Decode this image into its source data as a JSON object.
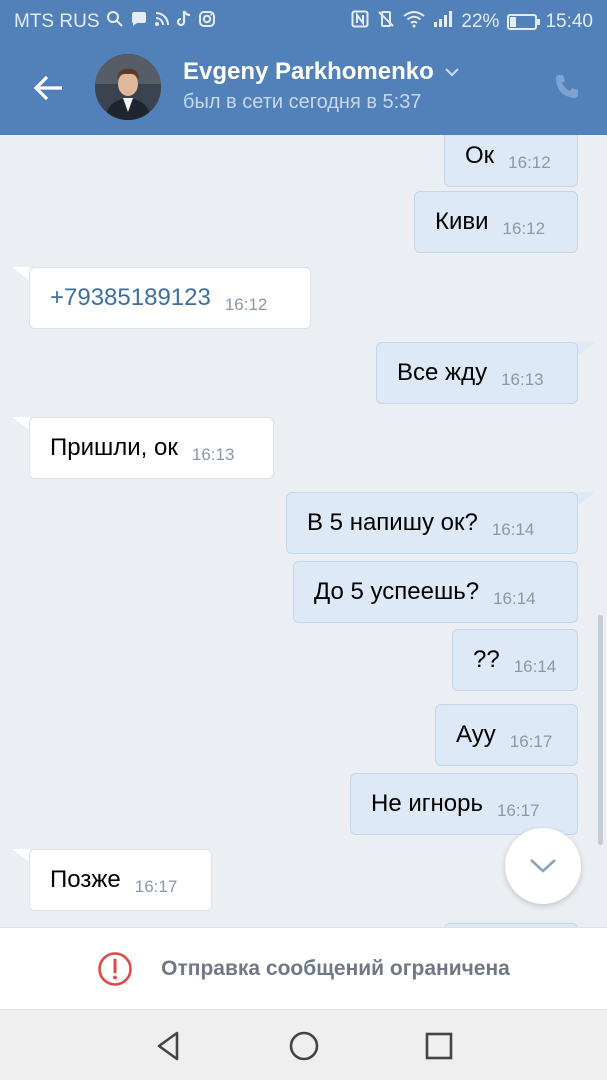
{
  "status_bar": {
    "carrier": "MTS RUS",
    "battery_percent_label": "22%",
    "battery_level": 0.22,
    "time": "15:40"
  },
  "header": {
    "contact_name": "Evgeny Parkhomenko",
    "last_seen": "был в сети сегодня в 5:37",
    "back_icon": "arrow-left-icon",
    "call_icon": "phone-icon"
  },
  "messages": [
    {
      "side": "out",
      "text": "Ок",
      "time": "16:12"
    },
    {
      "side": "out",
      "text": "Киви",
      "time": "16:12"
    },
    {
      "side": "in",
      "text": "+79385189123",
      "time": "16:12",
      "link": true
    },
    {
      "side": "out",
      "text": "Все жду",
      "time": "16:13"
    },
    {
      "side": "in",
      "text": "Пришли, ок",
      "time": "16:13"
    },
    {
      "side": "out",
      "text": "В 5 напишу ок?",
      "time": "16:14"
    },
    {
      "side": "out",
      "text": "До 5 успеешь?",
      "time": "16:14"
    },
    {
      "side": "out",
      "text": "??",
      "time": "16:14"
    },
    {
      "side": "out",
      "text": "Ауу",
      "time": "16:17"
    },
    {
      "side": "out",
      "text": "Не игнорь",
      "time": "16:17"
    },
    {
      "side": "in",
      "text": "Позже",
      "time": "16:17"
    }
  ],
  "restriction": {
    "text": "Отправка сообщений ограничена",
    "icon": "alert-circle-icon",
    "icon_color": "#e64646"
  },
  "colors": {
    "header_bg": "#5181b8",
    "outgoing_bubble": "#dde9f6",
    "incoming_bubble": "#ffffff",
    "chat_bg": "#ebeef2"
  }
}
